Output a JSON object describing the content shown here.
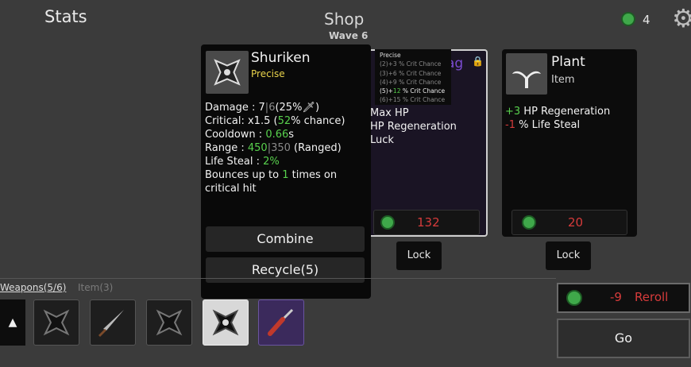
{
  "header": {
    "stats_label": "Stats",
    "shop_label": "Shop",
    "wave_label": "Wave 6",
    "coins": "4",
    "settings_icon": "gear-icon"
  },
  "tooltip": {
    "name": "Shuriken",
    "rarity": "Precise",
    "lines": {
      "damage_label": "Damage : ",
      "damage_a": "7",
      "damage_sep": "|",
      "damage_b": "6",
      "damage_pct": "(25%",
      "damage_tail": ")",
      "crit_label": "Critical: x1.5 (",
      "crit_chance": "52",
      "crit_tail": "% chance)",
      "cooldown_label": "Cooldown : ",
      "cooldown_val": "0.66",
      "cooldown_unit": "s",
      "range_label": "Range : ",
      "range_a": "450",
      "range_sep": "|",
      "range_b": "350",
      "range_tail": " (Ranged)",
      "lifesteal_label": "Life Steal : ",
      "lifesteal_val": "2%",
      "bounce_pre": "Bounces up to ",
      "bounce_val": "1",
      "bounce_post": " times on critical hit"
    },
    "combine_label": "Combine",
    "recycle_label": "Recycle(5)"
  },
  "mini_tooltip": {
    "title": "Precise",
    "lines": [
      "(2)+3 % Crit Chance",
      "(3)+6 % Crit Chance",
      "(4)+9 % Crit Chance"
    ],
    "active_prefix": "(5)+",
    "active_value": "12",
    "active_suffix": " % Crit Chance",
    "last_line": "(6)+15 % Crit Chance"
  },
  "middle_card": {
    "title_partial": "ag",
    "line1": "Max HP",
    "line2": "HP Regeneration",
    "line3": "Luck",
    "price": "132",
    "lock_label": "Lock"
  },
  "plant_card": {
    "name": "Plant",
    "type": "Item",
    "stat1_val": "+3",
    "stat1_label": " HP Regeneration",
    "stat2_val": "-1",
    "stat2_label": " % Life Steal",
    "price": "20",
    "lock_label": "Lock"
  },
  "inventory": {
    "weapons_tab": "Weapons(5/6)",
    "items_tab": "Item(3)"
  },
  "reroll": {
    "cost": "-9",
    "label": "Reroll"
  },
  "go_label": "Go",
  "colors": {
    "green": "#58d14d",
    "red": "#d63b3b",
    "purple_rarity": "#7a4bd1",
    "coin": "#3fa84a"
  }
}
